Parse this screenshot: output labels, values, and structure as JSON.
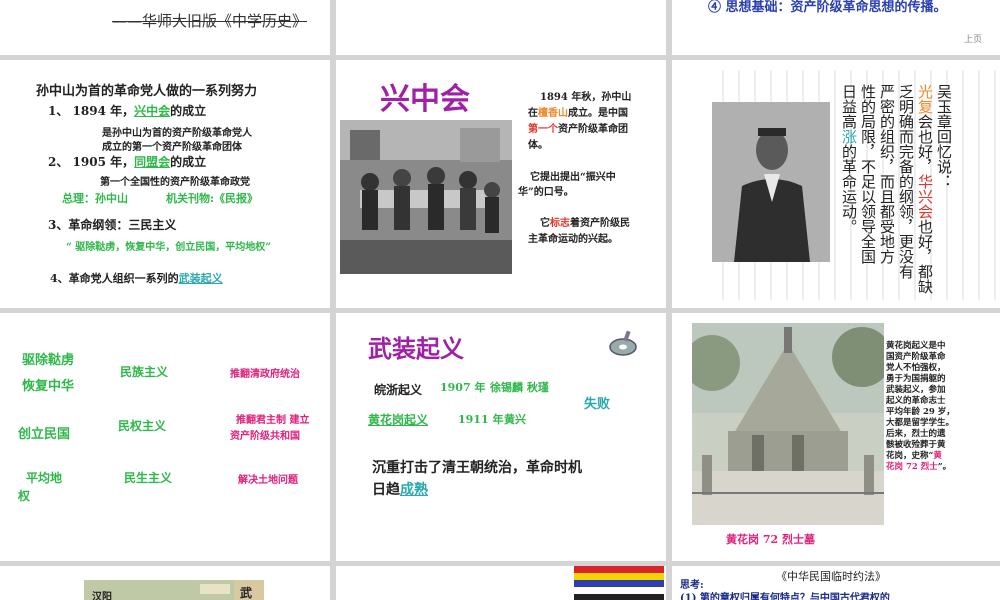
{
  "slide1": {
    "header": "——华师大旧版《中学历史》"
  },
  "slide3": {
    "point": "④ 思想基础：资产阶级革命思想的传播。",
    "page": "上页"
  },
  "slide4": {
    "title": "孙中山为首的革命党人做的一系列努力",
    "item1_prefix": "1、 1894 年，",
    "item1_org": "兴中会",
    "item1_suffix": "的成立",
    "item1_desc_a": "是孙中山为首的资产阶级革命党人",
    "item1_desc_b": "成立的第一个资产阶级革命团体",
    "item2_prefix": "2、 1905 年，",
    "item2_org": "同盟会",
    "item2_suffix": "的成立",
    "item2_desc": "第一个全国性的资产阶级革命政党",
    "leader": "总理：孙中山",
    "journal": "机关刊物:《民报》",
    "item3": "3、革命纲领：三民主义",
    "program": "“ 驱除鞑虏，恢复中华，创立民国，平均地权”",
    "item4_prefix": "4、革命党人组织一系列的",
    "item4_link": "武装起义"
  },
  "slide5": {
    "title": "兴中会",
    "p1_a": "1894 年秋，孙中山",
    "p1_b_pre": "在",
    "p1_b_place": "檀香山",
    "p1_b_post": "成立。是中国",
    "p1_c_first": "第一个",
    "p1_c_post": "资产阶级革命团",
    "p1_d": "体。",
    "p2_a": "它提出提出“振兴中",
    "p2_b": "华”的口号。",
    "p3_a_pre": "它",
    "p3_a_mark": "标志",
    "p3_a_post": "着资产阶级民",
    "p3_b": "主革命运动的兴起。"
  },
  "slide6": {
    "columns": [
      "吴玉章回忆说：",
      "光复会也好，华兴会也好，都缺",
      "乏明确而完备的纲领，更没有",
      "严密的组织，而且都受地方",
      "性的局限，不足以领导全国",
      "日益高涨的革命运动。"
    ]
  },
  "slide7": {
    "rows": [
      {
        "slogan": "驱除鞑虏",
        "principle": "民族主义",
        "goal": "推翻清政府统治"
      },
      {
        "slogan": "恢复中华",
        "principle": "",
        "goal": ""
      },
      {
        "slogan": "创立民国",
        "principle": "民权主义",
        "goal": "推翻君主制  建立",
        "goal2": "资产阶级共和国"
      },
      {
        "slogan": "平均地",
        "slogan2": "权",
        "principle": "民生主义",
        "goal": "解决土地问题"
      }
    ]
  },
  "slide8": {
    "title": "武装起义",
    "r1_a": "皖浙起义",
    "r1_b": "1907 年",
    "r1_c": "徐锡麟 秋瑾",
    "r2_a": "黄花岗起义",
    "r2_b": "1911 年",
    "r2_c": "黄兴",
    "result": "失败",
    "summary_a": "沉重打击了清王朝统治，革命时机",
    "summary_b_pre": "日趋",
    "summary_b_link": "成熟"
  },
  "slide9": {
    "lines": [
      "黄花岗起义是中",
      "国资产阶级革命",
      "党人不怕强权，",
      "勇于为国捐躯的",
      "武装起义，参加",
      "起义的革命志士",
      "平均年龄 29 岁，",
      "大都是留学学生。",
      "后来，烈士的遗",
      "骸被收殓葬于黄",
      "花岗，史称“黄",
      "花岗 72 烈士”。"
    ],
    "caption": "黄花岗 72 烈士墓"
  },
  "slide10": {
    "map_label1": "汉阳",
    "map_label2": "武"
  },
  "slide12": {
    "title": "《中华民国临时约法》",
    "think": "思考:",
    "q1": "(1) 第的章权归属有何特点？与中国古代君权的"
  },
  "colors": {
    "green": "#2fb84a",
    "teal": "#2aa9b0",
    "red": "#e0352b",
    "magenta": "#e0207a",
    "purple": "#a020a8"
  }
}
